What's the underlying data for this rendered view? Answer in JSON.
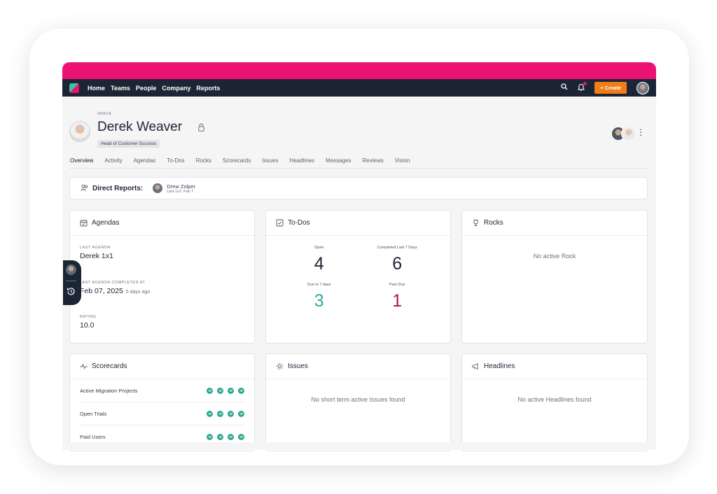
{
  "nav": {
    "links": [
      "Home",
      "Teams",
      "People",
      "Company",
      "Reports"
    ],
    "create_label": "+ Create",
    "icons": [
      "search-icon",
      "bell-icon"
    ]
  },
  "header": {
    "space_label": "SPACE",
    "name": "Derek Weaver",
    "role": "Head of Customer Success"
  },
  "tabs": [
    "Overview",
    "Activity",
    "Agendas",
    "To-Dos",
    "Rocks",
    "Scorecards",
    "Issues",
    "Headlines",
    "Messages",
    "Reviews",
    "Vision"
  ],
  "direct_reports": {
    "title": "Direct Reports:",
    "person": "Drew Zolper",
    "person_sub": "Last 1x1:  Feb 7"
  },
  "agendas": {
    "title": "Agendas",
    "last_agenda_label": "LAST AGENDA",
    "last_agenda": "Derek 1x1",
    "completed_label": "LAST AGENDA COMPLETED AT",
    "completed_date": "Feb 07, 2025",
    "completed_ago": "5 days ago",
    "rating_label": "RATING",
    "rating": "10.0"
  },
  "todos": {
    "title": "To-Dos",
    "open_label": "Open",
    "open": "4",
    "completed_label": "Completed Last 7 Days",
    "completed": "6",
    "due_label": "Due in 7 days",
    "due": "3",
    "past_label": "Past Due",
    "past": "1"
  },
  "rocks": {
    "title": "Rocks",
    "empty": "No active Rock"
  },
  "scorecards": {
    "title": "Scorecards",
    "rows": [
      "Active Migration Projects",
      "Open Trials",
      "Paid Users"
    ]
  },
  "issues": {
    "title": "Issues",
    "empty": "No short term active Issues found"
  },
  "headlines": {
    "title": "Headlines",
    "empty": "No active Headlines found"
  },
  "colors": {
    "accent": "#ea1273",
    "nav_bg": "#1c2533",
    "create": "#f07d1a",
    "teal": "#2ea88c",
    "due": "#37a59f",
    "past": "#b3115b"
  }
}
